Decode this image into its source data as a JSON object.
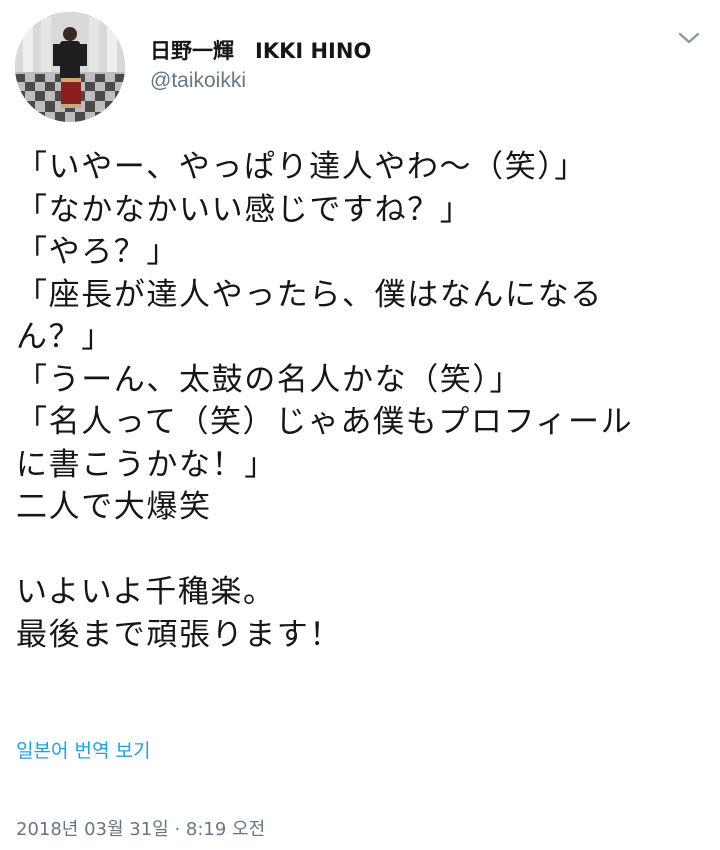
{
  "user": {
    "display_name": "日野一輝　IKKI HINO",
    "handle": "@taikoikki",
    "avatar_icon": "profile-photo"
  },
  "menu": {
    "caret_icon": "chevron-down-icon"
  },
  "tweet": {
    "lines": [
      "「いやー、やっぱり達人やわ～（笑）」",
      "「なかなかいい感じですね？」",
      "「やろ？」",
      "「座長が達人やったら、僕はなんになる",
      "ん？」",
      "「うーん、太鼓の名人かな（笑）」",
      "「名人って（笑）じゃあ僕もプロフィール",
      "に書こうかな！」",
      "二人で大爆笑",
      "",
      "いよいよ千穐楽。",
      "最後まで頑張ります！"
    ],
    "translate_label": "일본어 번역 보기",
    "timestamp": "2018년 03월 31일 · 8:19 오전"
  },
  "colors": {
    "text": "#14171a",
    "secondary": "#657786",
    "link": "#1da1f2"
  }
}
